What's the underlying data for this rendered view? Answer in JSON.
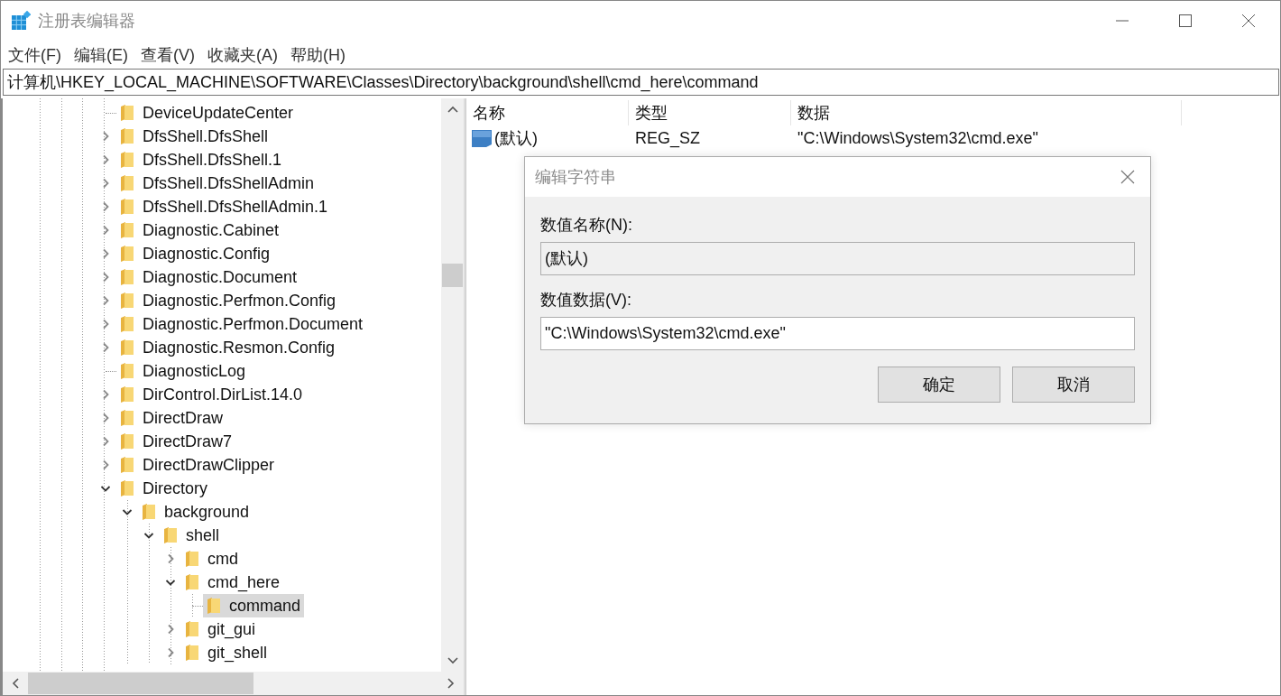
{
  "window": {
    "title": "注册表编辑器"
  },
  "menu": [
    {
      "label": "文件(F)"
    },
    {
      "label": "编辑(E)"
    },
    {
      "label": "查看(V)"
    },
    {
      "label": "收藏夹(A)"
    },
    {
      "label": "帮助(H)"
    }
  ],
  "address": "计算机\\HKEY_LOCAL_MACHINE\\SOFTWARE\\Classes\\Directory\\background\\shell\\cmd_here\\command",
  "tree": [
    {
      "name": "DeviceUpdateCenter",
      "expandable": false,
      "expanded": false,
      "selected": false
    },
    {
      "name": "DfsShell.DfsShell",
      "expandable": true,
      "expanded": false,
      "selected": false
    },
    {
      "name": "DfsShell.DfsShell.1",
      "expandable": true,
      "expanded": false,
      "selected": false
    },
    {
      "name": "DfsShell.DfsShellAdmin",
      "expandable": true,
      "expanded": false,
      "selected": false
    },
    {
      "name": "DfsShell.DfsShellAdmin.1",
      "expandable": true,
      "expanded": false,
      "selected": false
    },
    {
      "name": "Diagnostic.Cabinet",
      "expandable": true,
      "expanded": false,
      "selected": false
    },
    {
      "name": "Diagnostic.Config",
      "expandable": true,
      "expanded": false,
      "selected": false
    },
    {
      "name": "Diagnostic.Document",
      "expandable": true,
      "expanded": false,
      "selected": false
    },
    {
      "name": "Diagnostic.Perfmon.Config",
      "expandable": true,
      "expanded": false,
      "selected": false
    },
    {
      "name": "Diagnostic.Perfmon.Document",
      "expandable": true,
      "expanded": false,
      "selected": false
    },
    {
      "name": "Diagnostic.Resmon.Config",
      "expandable": true,
      "expanded": false,
      "selected": false
    },
    {
      "name": "DiagnosticLog",
      "expandable": false,
      "expanded": false,
      "selected": false
    },
    {
      "name": "DirControl.DirList.14.0",
      "expandable": true,
      "expanded": false,
      "selected": false
    },
    {
      "name": "DirectDraw",
      "expandable": true,
      "expanded": false,
      "selected": false
    },
    {
      "name": "DirectDraw7",
      "expandable": true,
      "expanded": false,
      "selected": false
    },
    {
      "name": "DirectDrawClipper",
      "expandable": true,
      "expanded": false,
      "selected": false
    },
    {
      "name": "Directory",
      "expandable": true,
      "expanded": true,
      "selected": false,
      "children": [
        {
          "name": "background",
          "expandable": true,
          "expanded": true,
          "selected": false,
          "children": [
            {
              "name": "shell",
              "expandable": true,
              "expanded": true,
              "selected": false,
              "children": [
                {
                  "name": "cmd",
                  "expandable": true,
                  "expanded": false,
                  "selected": false
                },
                {
                  "name": "cmd_here",
                  "expandable": true,
                  "expanded": true,
                  "selected": false,
                  "children": [
                    {
                      "name": "command",
                      "expandable": false,
                      "expanded": false,
                      "selected": true
                    }
                  ]
                },
                {
                  "name": "git_gui",
                  "expandable": true,
                  "expanded": false,
                  "selected": false
                },
                {
                  "name": "git_shell",
                  "expandable": true,
                  "expanded": false,
                  "selected": false
                }
              ]
            }
          ]
        }
      ]
    }
  ],
  "values": {
    "columns": [
      "名称",
      "类型",
      "数据"
    ],
    "rows": [
      {
        "name": "(默认)",
        "type": "REG_SZ",
        "data": "\"C:\\Windows\\System32\\cmd.exe\""
      }
    ]
  },
  "dialog": {
    "title": "编辑字符串",
    "name_label": "数值名称(N):",
    "name_value": "(默认)",
    "data_label": "数值数据(V):",
    "data_value": "\"C:\\Windows\\System32\\cmd.exe\"",
    "buttons": [
      "确定",
      "取消"
    ]
  }
}
